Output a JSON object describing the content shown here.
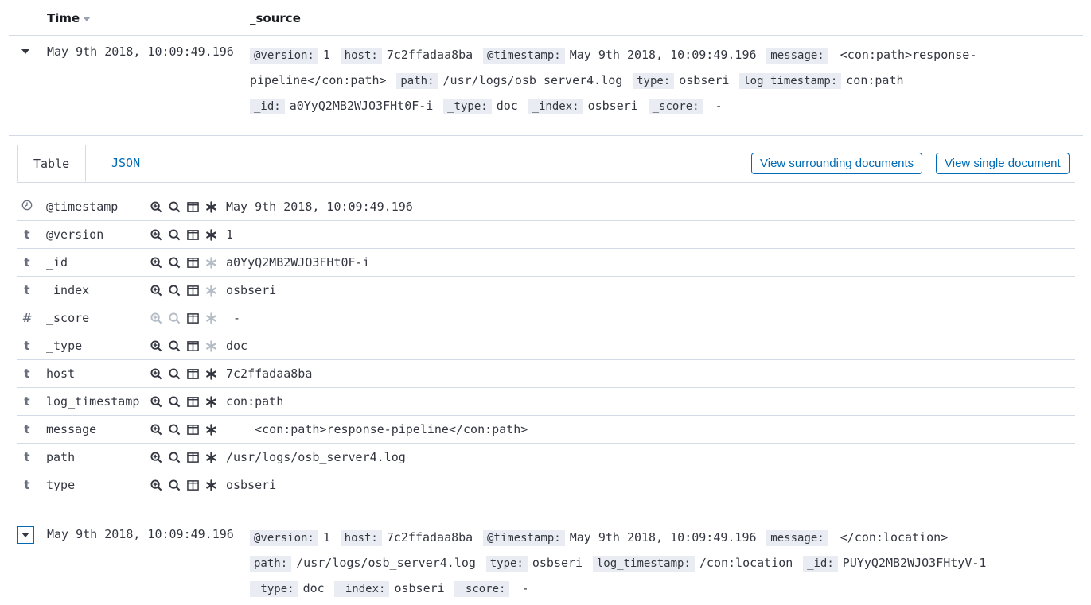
{
  "header": {
    "time_label": "Time",
    "source_label": "_source"
  },
  "doc1": {
    "timestamp": "May 9th 2018, 10:09:49.196",
    "source": [
      {
        "k": "@version:",
        "v": "1"
      },
      {
        "k": "host:",
        "v": "7c2ffadaa8ba"
      },
      {
        "k": "@timestamp:",
        "v": "May 9th 2018, 10:09:49.196"
      },
      {
        "k": "message:",
        "v": " <con:path>response-pipeline</con:path>"
      },
      {
        "k": "path:",
        "v": "/usr/logs/osb_server4.log"
      },
      {
        "k": "type:",
        "v": "osbseri"
      },
      {
        "k": "log_timestamp:",
        "v": "con:path"
      },
      {
        "k": "_id:",
        "v": "a0YyQ2MB2WJO3FHt0F-i"
      },
      {
        "k": "_type:",
        "v": "doc"
      },
      {
        "k": "_index:",
        "v": "osbseri"
      },
      {
        "k": "_score:",
        "v": " -"
      }
    ]
  },
  "details": {
    "tab_table": "Table",
    "tab_json": "JSON",
    "btn_surrounding": "View surrounding documents",
    "btn_single": "View single document",
    "fields": [
      {
        "type": "clock",
        "name": "@timestamp",
        "value": "May 9th 2018, 10:09:49.196",
        "exists": true,
        "filter": true
      },
      {
        "type": "t",
        "name": "@version",
        "value": "1",
        "exists": true,
        "filter": true
      },
      {
        "type": "t",
        "name": "_id",
        "value": "a0YyQ2MB2WJO3FHt0F-i",
        "exists": false,
        "filter": true
      },
      {
        "type": "t",
        "name": "_index",
        "value": "osbseri",
        "exists": false,
        "filter": true
      },
      {
        "type": "#",
        "name": "_score",
        "value": " -",
        "exists": false,
        "filter": false
      },
      {
        "type": "t",
        "name": "_type",
        "value": "doc",
        "exists": false,
        "filter": true
      },
      {
        "type": "t",
        "name": "host",
        "value": "7c2ffadaa8ba",
        "exists": true,
        "filter": true
      },
      {
        "type": "t",
        "name": "log_timestamp",
        "value": "con:path",
        "exists": true,
        "filter": true
      },
      {
        "type": "t",
        "name": "message",
        "value": "    <con:path>response-pipeline</con:path>",
        "exists": true,
        "filter": true
      },
      {
        "type": "t",
        "name": "path",
        "value": "/usr/logs/osb_server4.log",
        "exists": true,
        "filter": true
      },
      {
        "type": "t",
        "name": "type",
        "value": "osbseri",
        "exists": true,
        "filter": true
      }
    ]
  },
  "doc2": {
    "timestamp": "May 9th 2018, 10:09:49.196",
    "source": [
      {
        "k": "@version:",
        "v": "1"
      },
      {
        "k": "host:",
        "v": "7c2ffadaa8ba"
      },
      {
        "k": "@timestamp:",
        "v": "May 9th 2018, 10:09:49.196"
      },
      {
        "k": "message:",
        "v": " </con:location>"
      },
      {
        "k": "path:",
        "v": "/usr/logs/osb_server4.log"
      },
      {
        "k": "type:",
        "v": "osbseri"
      },
      {
        "k": "log_timestamp:",
        "v": "/con:location"
      },
      {
        "k": "_id:",
        "v": "PUYyQ2MB2WJO3FHtyV-1"
      },
      {
        "k": "_type:",
        "v": "doc"
      },
      {
        "k": "_index:",
        "v": "osbseri"
      },
      {
        "k": "_score:",
        "v": " -"
      }
    ]
  }
}
